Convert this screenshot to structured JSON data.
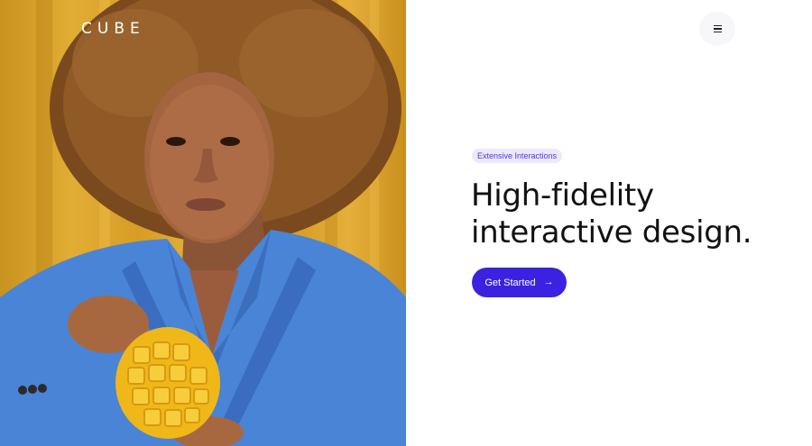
{
  "brand": {
    "name": "CUBE"
  },
  "header": {
    "menu_icon": "hamburger-menu-icon"
  },
  "hero": {
    "badge": "Extensive Interactions",
    "headline_line1": "High-fidelity",
    "headline_line2": "interactive design.",
    "cta_label": "Get Started",
    "cta_icon": "→"
  },
  "colors": {
    "accent": "#3b22e0",
    "badge_bg": "#ece8fd",
    "badge_text": "#4b3bd6",
    "backdrop": "#e2ad35",
    "jacket": "#4a84d6"
  }
}
